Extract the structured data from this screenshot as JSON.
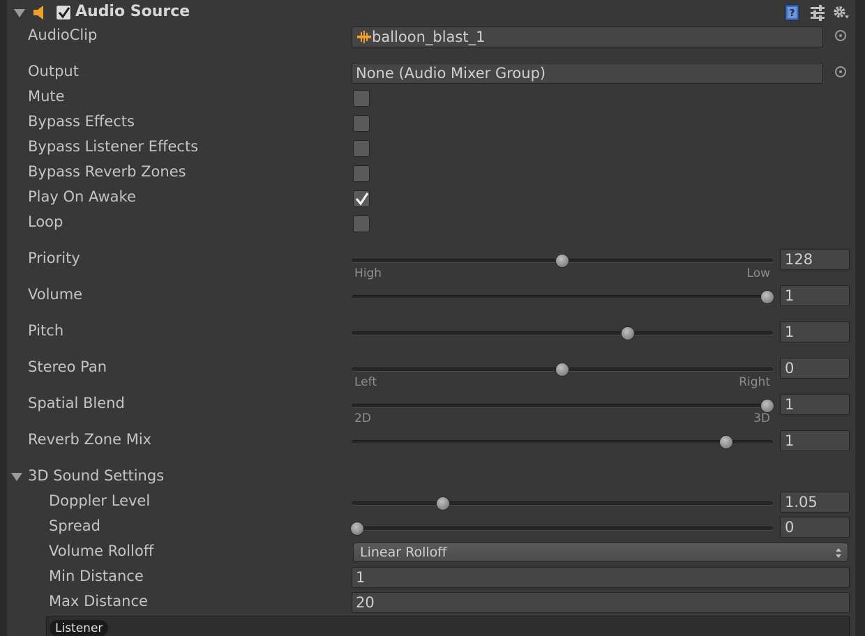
{
  "header": {
    "title": "Audio Source",
    "enabled": true,
    "icons": [
      "fold-arrow-icon",
      "speaker-icon",
      "help-icon",
      "preset-icon",
      "gear-icon"
    ]
  },
  "audio_clip": {
    "label": "AudioClip",
    "value": "balloon_blast_1"
  },
  "output": {
    "label": "Output",
    "value": "None (Audio Mixer Group)"
  },
  "toggles": [
    {
      "label": "Mute",
      "checked": false
    },
    {
      "label": "Bypass Effects",
      "checked": false
    },
    {
      "label": "Bypass Listener Effects",
      "checked": false
    },
    {
      "label": "Bypass Reverb Zones",
      "checked": false
    },
    {
      "label": "Play On Awake",
      "checked": true
    },
    {
      "label": "Loop",
      "checked": false
    }
  ],
  "sliders": [
    {
      "label": "Priority",
      "value": "128",
      "fraction": 0.5,
      "caption_left": "High",
      "caption_right": "Low"
    },
    {
      "label": "Volume",
      "value": "1",
      "fraction": 1.0
    },
    {
      "label": "Pitch",
      "value": "1",
      "fraction": 0.66
    },
    {
      "label": "Stereo Pan",
      "value": "0",
      "fraction": 0.5,
      "caption_left": "Left",
      "caption_right": "Right"
    },
    {
      "label": "Spatial Blend",
      "value": "1",
      "fraction": 1.0,
      "caption_left": "2D",
      "caption_right": "3D"
    },
    {
      "label": "Reverb Zone Mix",
      "value": "1",
      "fraction": 0.9
    }
  ],
  "sound3d": {
    "label": "3D Sound Settings",
    "doppler": {
      "label": "Doppler Level",
      "value": "1.05",
      "fraction": 0.21
    },
    "spread": {
      "label": "Spread",
      "value": "0",
      "fraction": 0.0
    },
    "rolloff": {
      "label": "Volume Rolloff",
      "value": "Linear Rolloff"
    },
    "min_distance": {
      "label": "Min Distance",
      "value": "1"
    },
    "max_distance": {
      "label": "Max Distance",
      "value": "20"
    },
    "graph_badge": "Listener"
  },
  "colors": {
    "background": "#383838",
    "accent_orange": "#f0a028",
    "help_blue": "#3f6fbf"
  }
}
